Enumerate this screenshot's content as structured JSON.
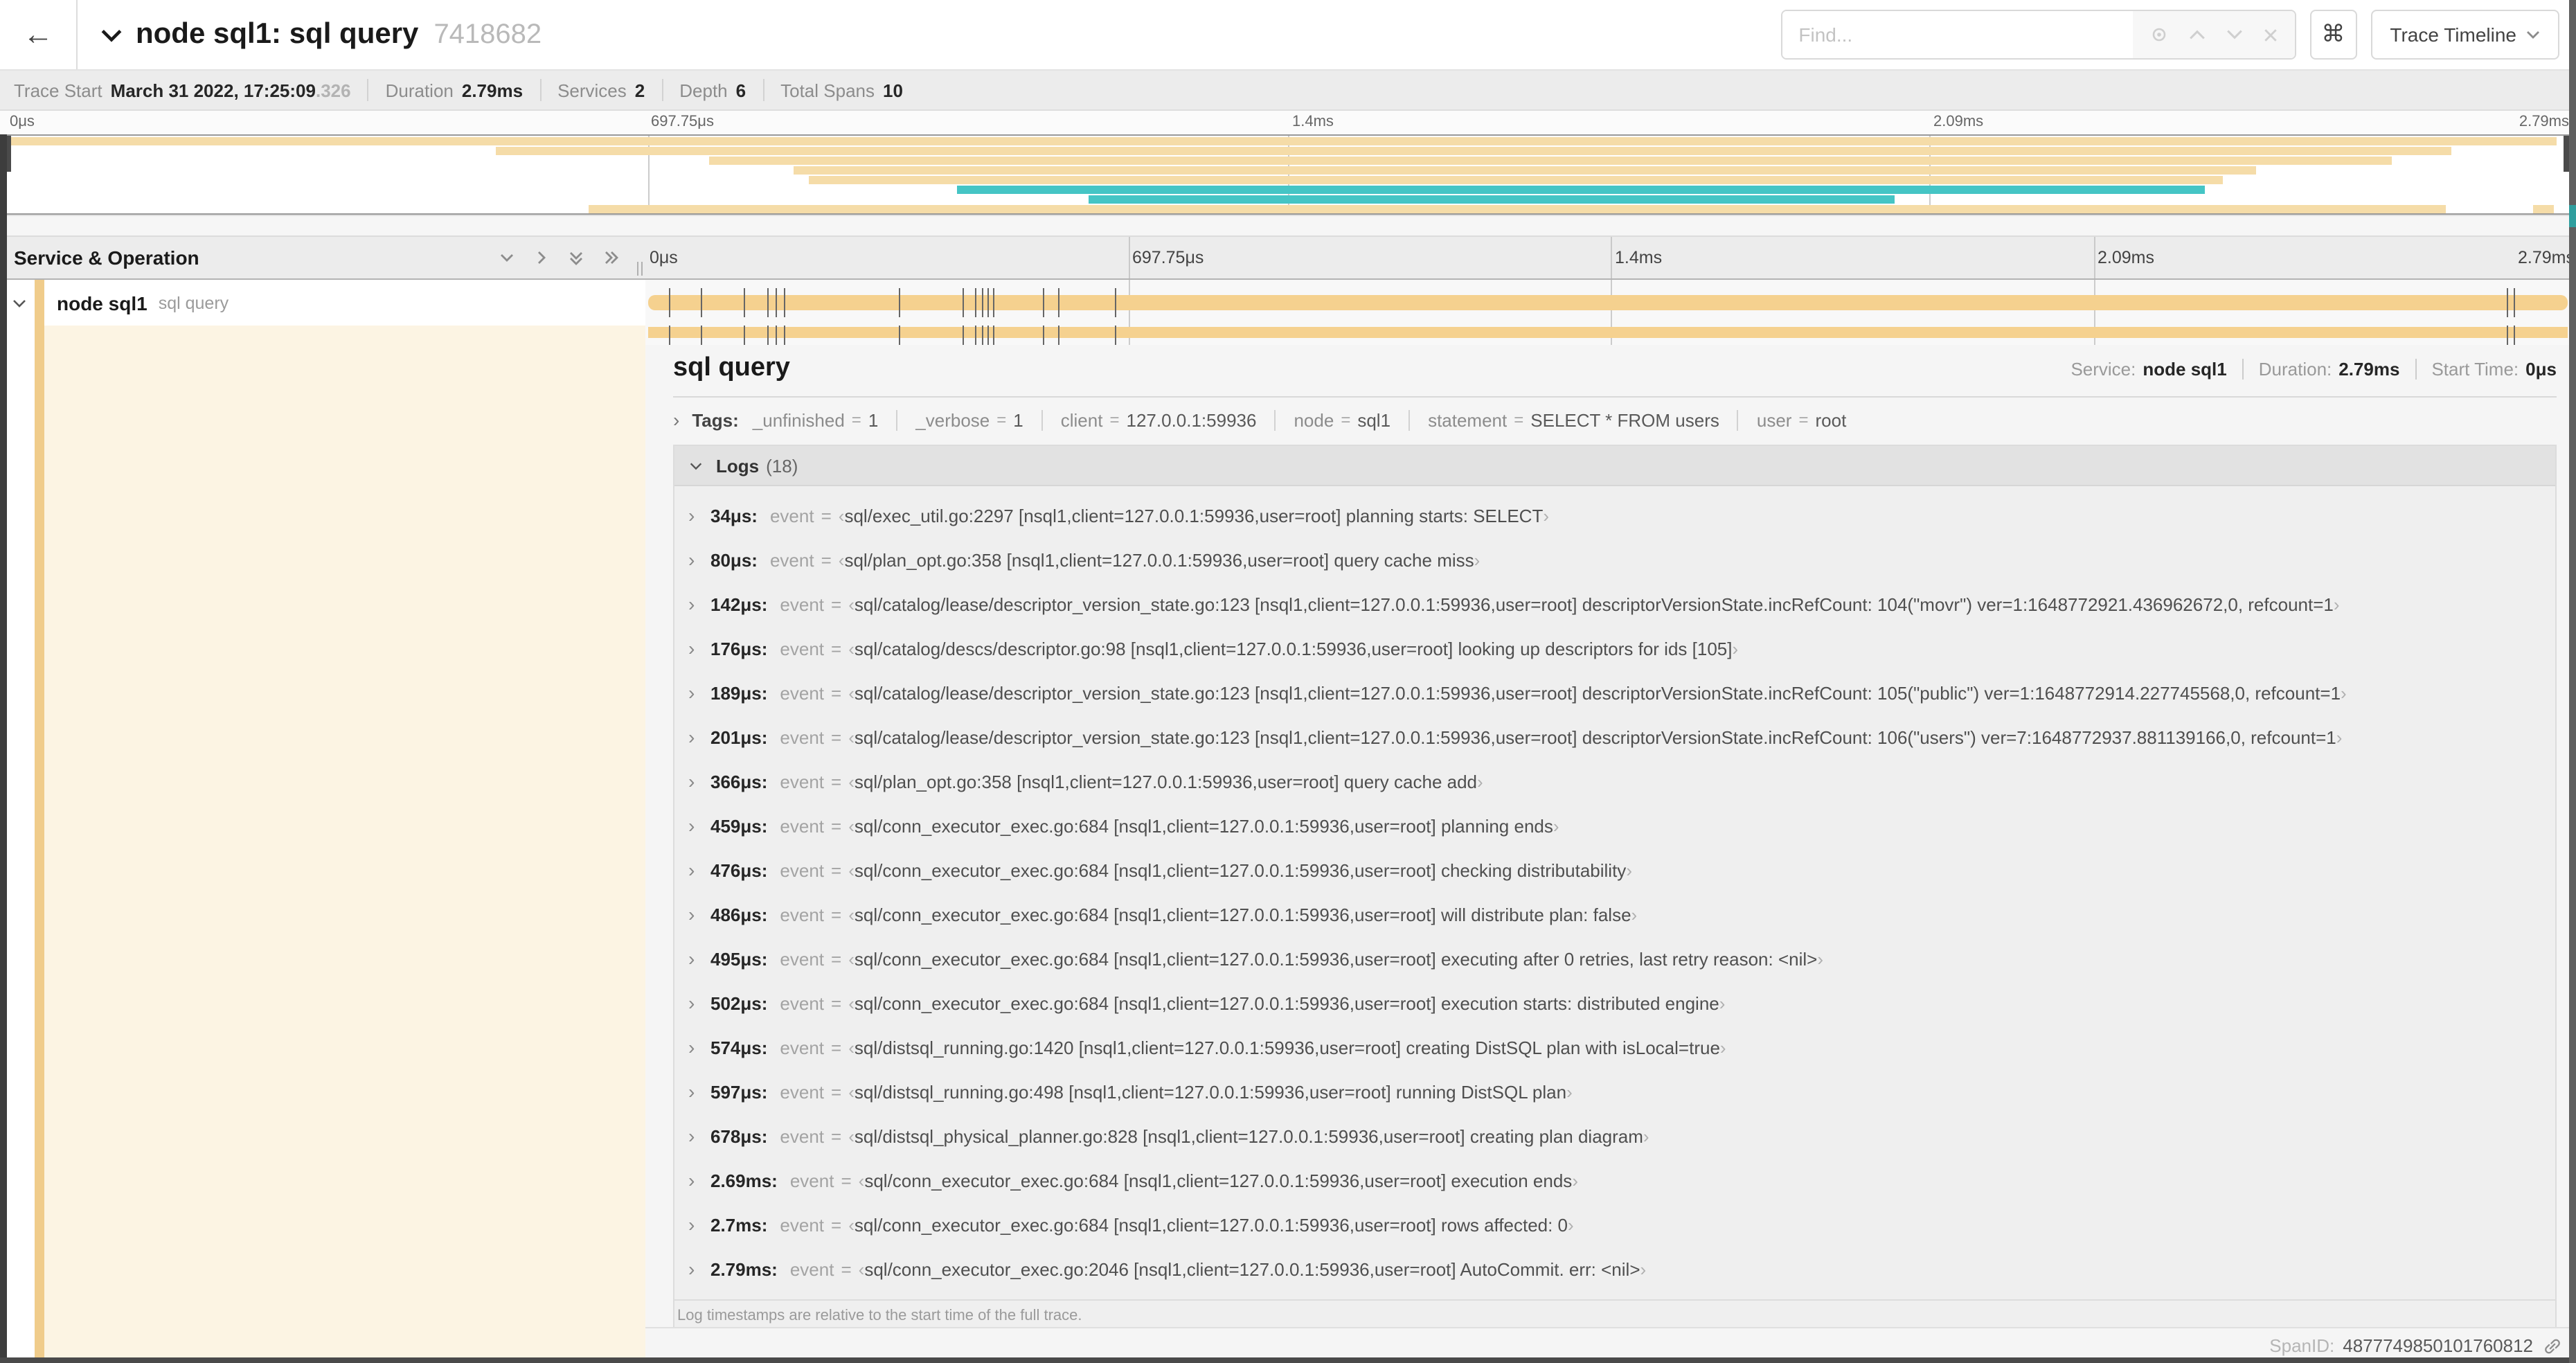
{
  "header": {
    "title": "node sql1: sql query",
    "trace_id": "7418682",
    "find_placeholder": "Find...",
    "view_button": "Trace Timeline"
  },
  "icons": {
    "back": "←",
    "command": "⌘",
    "chevron_right": "›",
    "open_quote": "‹",
    "close_quote": "›"
  },
  "meta": {
    "items": [
      {
        "label": "Trace Start",
        "value": "March 31 2022, 17:25:09",
        "suffix": ".326"
      },
      {
        "label": "Duration",
        "value": "2.79ms",
        "suffix": ""
      },
      {
        "label": "Services",
        "value": "2",
        "suffix": ""
      },
      {
        "label": "Depth",
        "value": "6",
        "suffix": ""
      },
      {
        "label": "Total Spans",
        "value": "10",
        "suffix": ""
      }
    ]
  },
  "timeline": {
    "ticks": [
      "0μs",
      "697.75μs",
      "1.4ms",
      "2.09ms",
      "2.79ms"
    ],
    "tick_positions": [
      0,
      25,
      50,
      75,
      100
    ],
    "total_us": 2790
  },
  "minimap": {
    "bars": [
      {
        "row": 0,
        "start": 0,
        "end": 99.5,
        "color": "tan"
      },
      {
        "row": 1,
        "start": 19.1,
        "end": 95.4,
        "color": "tan"
      },
      {
        "row": 2,
        "start": 27.4,
        "end": 93.1,
        "color": "tan"
      },
      {
        "row": 3,
        "start": 30.7,
        "end": 87.8,
        "color": "tan"
      },
      {
        "row": 4,
        "start": 31.3,
        "end": 86.5,
        "color": "tan"
      },
      {
        "row": 5,
        "start": 37.1,
        "end": 85.8,
        "color": "teal"
      },
      {
        "row": 6,
        "start": 42.2,
        "end": 73.7,
        "color": "teal"
      },
      {
        "row": 7,
        "start": 22.7,
        "end": 95.2,
        "color": "tan"
      },
      {
        "row": 7,
        "start": 98.6,
        "end": 99.4,
        "color": "tan"
      }
    ]
  },
  "grid_header": {
    "left_title": "Service & Operation"
  },
  "span_row": {
    "service": "node sql1",
    "operation": "sql query"
  },
  "detail": {
    "title": "sql query",
    "service_label": "Service:",
    "service": "node sql1",
    "duration_label": "Duration:",
    "duration": "2.79ms",
    "start_label": "Start Time:",
    "start": "0μs"
  },
  "tags": {
    "label": "Tags:",
    "items": [
      {
        "key": "_unfinished",
        "value": "1"
      },
      {
        "key": "_verbose",
        "value": "1"
      },
      {
        "key": "client",
        "value": "127.0.0.1:59936"
      },
      {
        "key": "node",
        "value": "sql1"
      },
      {
        "key": "statement",
        "value": "SELECT * FROM users"
      },
      {
        "key": "user",
        "value": "root"
      }
    ]
  },
  "logs": {
    "label": "Logs",
    "count": "(18)",
    "event_prefix": "event",
    "equals": "=",
    "context": "[nsql1,client=127.0.0.1:59936,user=root]",
    "entries": [
      {
        "time": "34μs",
        "t_us": 34,
        "file": "sql/exec_util.go:2297",
        "message": "planning starts: SELECT"
      },
      {
        "time": "80μs",
        "t_us": 80,
        "file": "sql/plan_opt.go:358",
        "message": "query cache miss"
      },
      {
        "time": "142μs",
        "t_us": 142,
        "file": "sql/catalog/lease/descriptor_version_state.go:123",
        "message": "descriptorVersionState.incRefCount: 104(\"movr\") ver=1:1648772921.436962672,0, refcount=1"
      },
      {
        "time": "176μs",
        "t_us": 176,
        "file": "sql/catalog/descs/descriptor.go:98",
        "message": "looking up descriptors for ids [105]"
      },
      {
        "time": "189μs",
        "t_us": 189,
        "file": "sql/catalog/lease/descriptor_version_state.go:123",
        "message": "descriptorVersionState.incRefCount: 105(\"public\") ver=1:1648772914.227745568,0, refcount=1"
      },
      {
        "time": "201μs",
        "t_us": 201,
        "file": "sql/catalog/lease/descriptor_version_state.go:123",
        "message": "descriptorVersionState.incRefCount: 106(\"users\") ver=7:1648772937.881139166,0, refcount=1"
      },
      {
        "time": "366μs",
        "t_us": 366,
        "file": "sql/plan_opt.go:358",
        "message": "query cache add"
      },
      {
        "time": "459μs",
        "t_us": 459,
        "file": "sql/conn_executor_exec.go:684",
        "message": "planning ends"
      },
      {
        "time": "476μs",
        "t_us": 476,
        "file": "sql/conn_executor_exec.go:684",
        "message": "checking distributability"
      },
      {
        "time": "486μs",
        "t_us": 486,
        "file": "sql/conn_executor_exec.go:684",
        "message": "will distribute plan: false"
      },
      {
        "time": "495μs",
        "t_us": 495,
        "file": "sql/conn_executor_exec.go:684",
        "message": "executing after 0 retries, last retry reason: <nil>"
      },
      {
        "time": "502μs",
        "t_us": 502,
        "file": "sql/conn_executor_exec.go:684",
        "message": "execution starts: distributed engine"
      },
      {
        "time": "574μs",
        "t_us": 574,
        "file": "sql/distsql_running.go:1420",
        "message": "creating DistSQL plan with isLocal=true"
      },
      {
        "time": "597μs",
        "t_us": 597,
        "file": "sql/distsql_running.go:498",
        "message": "running DistSQL plan"
      },
      {
        "time": "678μs",
        "t_us": 678,
        "file": "sql/distsql_physical_planner.go:828",
        "message": "creating plan diagram"
      },
      {
        "time": "2.69ms",
        "t_us": 2690,
        "file": "sql/conn_executor_exec.go:684",
        "message": "execution ends"
      },
      {
        "time": "2.7ms",
        "t_us": 2700,
        "file": "sql/conn_executor_exec.go:684",
        "message": "rows affected: 0"
      },
      {
        "time": "2.79ms",
        "t_us": 2790,
        "file": "sql/conn_executor_exec.go:2046",
        "message": "AutoCommit. err: <nil>"
      }
    ],
    "note": "Log timestamps are relative to the start time of the full trace."
  },
  "footer": {
    "label": "SpanID:",
    "value": "4877749850101760812"
  },
  "colors": {
    "span_bar": "#F5D18F",
    "minimap_tan": "#F5DCA8",
    "teal": "#45C5C5",
    "accent": "#F0CC8B",
    "cream": "#FCF4E3"
  }
}
